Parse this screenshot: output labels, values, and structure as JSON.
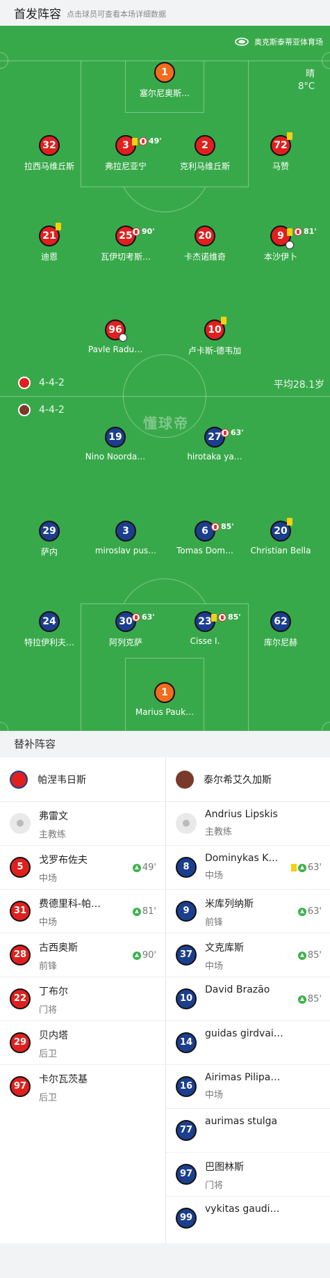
{
  "header": {
    "title": "首发阵容",
    "subtitle": "点击球员可查看本场详细数据"
  },
  "venue": {
    "name": "奥克斯泰蒂亚体育场"
  },
  "weather": {
    "condition": "晴",
    "temp": "8°C"
  },
  "home": {
    "formation": "4-4-2",
    "color": "#e0201e",
    "players": [
      {
        "num": "1",
        "name": "塞尔尼奥斯…"
      },
      {
        "num": "32",
        "name": "拉西马维丘斯"
      },
      {
        "num": "3",
        "name": "弗拉尼亚宁",
        "event_time": "49'"
      },
      {
        "num": "2",
        "name": "克利马维丘斯"
      },
      {
        "num": "72",
        "name": "马赞"
      },
      {
        "num": "21",
        "name": "迪恩"
      },
      {
        "num": "25",
        "name": "瓦伊切考斯…",
        "event_time": "90'"
      },
      {
        "num": "20",
        "name": "卡杰诺维奇"
      },
      {
        "num": "9",
        "name": "本沙伊卜",
        "event_time": "81'"
      },
      {
        "num": "96",
        "name": "Pavle Radu…"
      },
      {
        "num": "10",
        "name": "卢卡斯-德韦加"
      }
    ]
  },
  "away": {
    "formation": "4-4-2",
    "avg_age": "平均28.1岁",
    "color": "#1b3f8e",
    "players": [
      {
        "num": "19",
        "name": "Nino Noorda…"
      },
      {
        "num": "27",
        "name": "hirotaka ya…",
        "event_time": "63'"
      },
      {
        "num": "29",
        "name": "萨内"
      },
      {
        "num": "3",
        "name": "miroslav pus…"
      },
      {
        "num": "6",
        "name": "Tomas Dom…",
        "event_time": "85'"
      },
      {
        "num": "20",
        "name": "Christian Bella"
      },
      {
        "num": "24",
        "name": "特拉伊利夫…"
      },
      {
        "num": "30",
        "name": "阿列克萨",
        "event_time": "63'"
      },
      {
        "num": "23",
        "name": "Cisse I.",
        "event_time": "85'"
      },
      {
        "num": "62",
        "name": "库尔尼赫"
      },
      {
        "num": "1",
        "name": "Marius Pauk…"
      }
    ]
  },
  "center_logo": "懂球帝",
  "subs": {
    "title": "替补阵容",
    "home": {
      "team": "帕涅韦日斯",
      "coach": {
        "name": "弗雷文",
        "role": "主教练"
      },
      "players": [
        {
          "num": "5",
          "name": "戈罗布佐夫",
          "pos": "中场",
          "sub_time": "49'"
        },
        {
          "num": "31",
          "name": "费德里科-帕…",
          "pos": "中场",
          "sub_time": "81'"
        },
        {
          "num": "28",
          "name": "古西奥斯",
          "pos": "前锋",
          "sub_time": "90'"
        },
        {
          "num": "22",
          "name": "丁布尔",
          "pos": "门将",
          "sub_time": ""
        },
        {
          "num": "29",
          "name": "贝内塔",
          "pos": "后卫",
          "sub_time": ""
        },
        {
          "num": "97",
          "name": "卡尔瓦茨基",
          "pos": "后卫",
          "sub_time": ""
        }
      ]
    },
    "away": {
      "team": "泰尔希艾久加斯",
      "coach": {
        "name": "Andrius Lipskis",
        "role": "主教练"
      },
      "players": [
        {
          "num": "8",
          "name": "Dominykas K…",
          "pos": "中场",
          "sub_time": "63'"
        },
        {
          "num": "9",
          "name": "米库列纳斯",
          "pos": "前锋",
          "sub_time": "63'"
        },
        {
          "num": "37",
          "name": "文克库斯",
          "pos": "中场",
          "sub_time": "85'"
        },
        {
          "num": "10",
          "name": "David Brazão",
          "pos": "",
          "sub_time": "85'"
        },
        {
          "num": "14",
          "name": "guidas girdvai…",
          "pos": "",
          "sub_time": ""
        },
        {
          "num": "16",
          "name": "Airimas Pilipa…",
          "pos": "中场",
          "sub_time": ""
        },
        {
          "num": "77",
          "name": "aurimas stulga",
          "pos": "",
          "sub_time": ""
        },
        {
          "num": "97",
          "name": "巴图林斯",
          "pos": "门将",
          "sub_time": ""
        },
        {
          "num": "99",
          "name": "vykitas gaudi…",
          "pos": "",
          "sub_time": ""
        }
      ]
    }
  }
}
